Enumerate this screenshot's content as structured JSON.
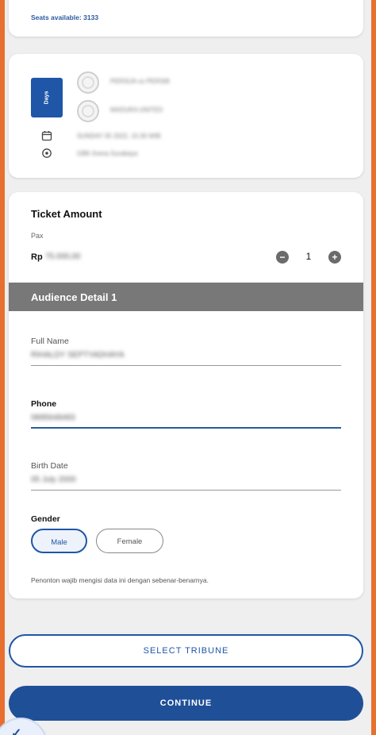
{
  "seats": {
    "text": "Seats available: 3133"
  },
  "event": {
    "date_badge": "Days",
    "team_home": "PERSIJA vs PERSIB",
    "team_away": "MADURA UNITED",
    "datetime": "SUNDAY 05 2022, 15:30 WIB",
    "venue": "GBK Arena Surabaya"
  },
  "ticket": {
    "title": "Ticket Amount",
    "pax_label": "Pax",
    "price_prefix": "Rp",
    "price_value": "75.000,00",
    "decrement": "−",
    "increment": "+",
    "quantity": "1"
  },
  "audience": {
    "section_title": "Audience Detail 1",
    "full_name_label": "Full Name",
    "full_name_value": "RIHALDY SEPTYADHAYA",
    "phone_label": "Phone",
    "phone_value": "0895648483",
    "birth_label": "Birth Date",
    "birth_value": "05 July 2000",
    "gender_label": "Gender",
    "gender_male": "Male",
    "gender_female": "Female",
    "note": "Penonton wajib mengisi data ini dengan sebenar-benarnya."
  },
  "actions": {
    "select_tribune": "SELECT TRIBUNE",
    "continue": "CONTINUE"
  },
  "colors": {
    "accent": "#1f4f97",
    "section_bar": "#787878",
    "frame": "#e8702f"
  }
}
